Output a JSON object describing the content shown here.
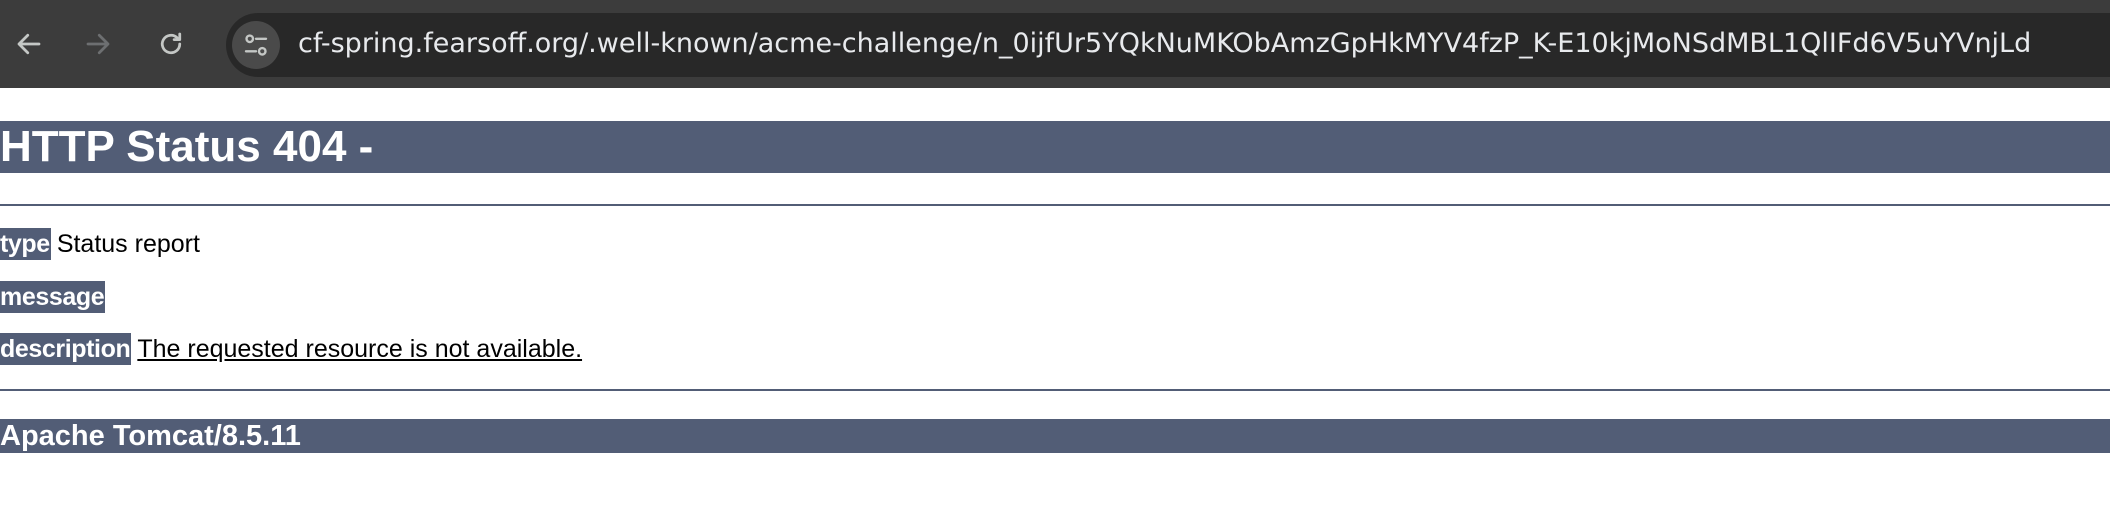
{
  "browser": {
    "url": "cf-spring.fearsoff.org/.well-known/acme-challenge/n_0ijfUr5YQkNuMKObAmzGpHkMYV4fzP_K-E10kjMoNSdMBL1QlIFd6V5uYVnjLd",
    "icons": {
      "back": "arrow-left-icon",
      "forward": "arrow-right-icon",
      "reload": "reload-icon",
      "site_info": "tune-icon"
    },
    "colors": {
      "toolbar": "#3c3c3c",
      "omnibox": "#282828",
      "text": "#e8eaed"
    }
  },
  "page": {
    "title": "HTTP Status 404 -",
    "type_label": "type",
    "type_value": "Status report",
    "message_label": "message",
    "message_value": "",
    "description_label": "description",
    "description_value": "The requested resource is not available.",
    "server_info": "Apache Tomcat/8.5.11",
    "colors": {
      "accent": "#525d76",
      "background": "#ffffff",
      "text": "#000000"
    }
  }
}
